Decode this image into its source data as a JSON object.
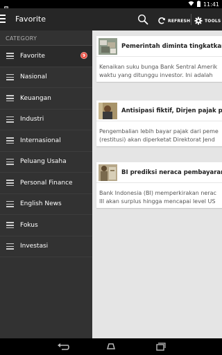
{
  "status_bar": {
    "time": "11:41"
  },
  "action_bar": {
    "title": "Favorite",
    "refresh_label": "REFRESH",
    "tools_label": "TOOLS"
  },
  "drawer": {
    "header": "CATEGORY",
    "items": [
      {
        "label": "Favorite",
        "badge": "9"
      },
      {
        "label": "Nasional"
      },
      {
        "label": "Keuangan"
      },
      {
        "label": "Industri"
      },
      {
        "label": "Internasional"
      },
      {
        "label": "Peluang Usaha"
      },
      {
        "label": "Personal Finance"
      },
      {
        "label": "English News"
      },
      {
        "label": "Fokus"
      },
      {
        "label": "Investasi"
      }
    ]
  },
  "articles": [
    {
      "title": "Pemerintah diminta tingkatkan in",
      "summary_line1": "Kenaikan suku bunga Bank Sentral Amerik",
      "summary_line2": "waktu yang ditunggu investor. Ini adalah"
    },
    {
      "title": "Antisipasi fiktif, Dirjen pajak perk",
      "summary_line1": "Pengembalian lebih bayar pajak dari peme",
      "summary_line2": "(restitusi) akan diperketat Direktorat Jend"
    },
    {
      "title": "BI prediksi neraca pembayaran tr",
      "summary_line1": "Bank Indonesia (BI) memperkirakan nerac",
      "summary_line2": "III akan surplus hingga mencapai level US"
    }
  ],
  "colors": {
    "action_bar_bg": "#262626",
    "drawer_bg": "#323232",
    "content_bg": "#e5e5e5",
    "badge": "#e8463a"
  }
}
